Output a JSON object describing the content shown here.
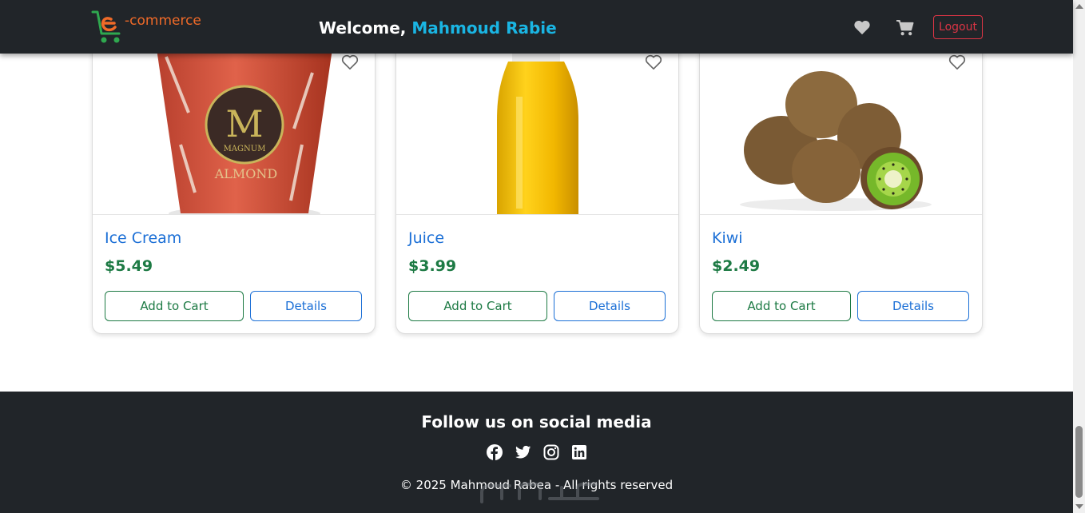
{
  "navbar": {
    "logo_text": "-commerce",
    "welcome_prefix": "Welcome,",
    "user_name": "Mahmoud Rabie",
    "logout_label": "Logout",
    "icons": [
      "heart-icon",
      "cart-icon"
    ]
  },
  "products": [
    {
      "name": "Ice Cream",
      "price": "$5.49",
      "cart_label": "Add to Cart",
      "details_label": "Details",
      "image": "ice-cream-tub"
    },
    {
      "name": "Juice",
      "price": "$3.99",
      "cart_label": "Add to Cart",
      "details_label": "Details",
      "image": "juice-bottle"
    },
    {
      "name": "Kiwi",
      "price": "$2.49",
      "cart_label": "Add to Cart",
      "details_label": "Details",
      "image": "kiwi-fruits"
    }
  ],
  "footer": {
    "title": "Follow us on social media",
    "social": [
      "facebook-icon",
      "twitter-icon",
      "instagram-icon",
      "linkedin-icon"
    ],
    "copyright": "© 2025 Mahmoud Rabea - All rights reserved"
  },
  "colors": {
    "navbar_bg": "#212529",
    "accent_user": "#1ab5e3",
    "title_blue": "#1b6fd6",
    "price_green": "#1d7a44",
    "logout_red": "#dc3545",
    "logo_orange": "#f06a28"
  }
}
